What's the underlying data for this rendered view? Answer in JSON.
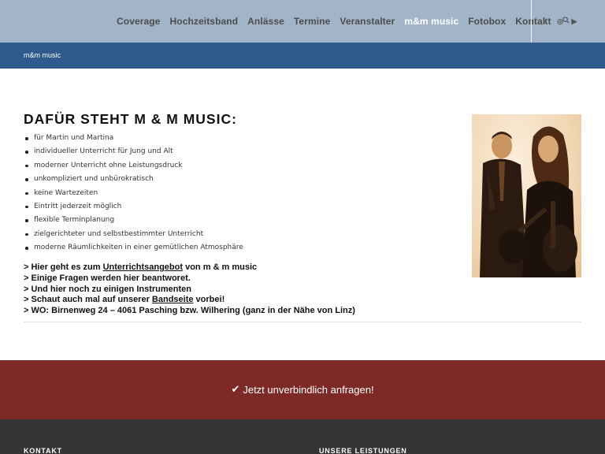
{
  "nav": {
    "items": [
      {
        "label": "Coverage",
        "active": false
      },
      {
        "label": "Hochzeitsband",
        "active": false
      },
      {
        "label": "Anlässe",
        "active": false
      },
      {
        "label": "Termine",
        "active": false
      },
      {
        "label": "Veranstalter",
        "active": false
      },
      {
        "label": "m&m music",
        "active": true
      },
      {
        "label": "Fotobox",
        "active": false
      },
      {
        "label": "Kontakt",
        "active": false
      }
    ],
    "search_icon": "search-icon",
    "social": [
      {
        "icon": "facebook-icon",
        "glyph": "f"
      },
      {
        "icon": "instagram-icon",
        "glyph": "◎"
      },
      {
        "icon": "youtube-icon",
        "glyph": "▶"
      }
    ]
  },
  "breadcrumb": "m&m music",
  "main": {
    "title": "DAFÜR STEHT M & M MUSIC:",
    "bullets": [
      "für Martin und Martina",
      "individueller Unterricht für Jung und Alt",
      "moderner Unterricht ohne Leistungsdruck",
      "unkompliziert und unbürokratisch",
      "keine Wartezeiten",
      "Eintritt jederzeit möglich",
      "flexible Terminplanung",
      "zielgerichteter und selbstbestimmter Unterricht",
      "moderne Räumlichkeiten in einer gemütlichen Atmosphäre"
    ],
    "links": {
      "line1_pre": "> Hier geht es zum ",
      "line1_link": "Unterrichtsangebot",
      "line1_post": " von m & m music",
      "line2": "> Einige Fragen werden hier beantworet.",
      "line3": "> Und hier noch zu einigen Instrumenten",
      "line4_pre": " > Schaut auch mal auf unserer ",
      "line4_link": "Bandseite",
      "line4_post": " vorbei!",
      "line5": " > WO: Birnenweg 24 – 4061 Pasching bzw. Wilhering (ganz in der Nähe von Linz)"
    }
  },
  "cta": {
    "icon": "checkmark-icon",
    "label": "Jetzt unverbindlich anfragen!"
  },
  "footer": {
    "col1": "KONTAKT",
    "col2": "UNSERE LEISTUNGEN"
  },
  "colors": {
    "header_bg": "#a2b5c8",
    "titlebar_bg": "#2e5b8b",
    "cta_bg": "#7d2a27",
    "footer_bg": "#343536"
  }
}
